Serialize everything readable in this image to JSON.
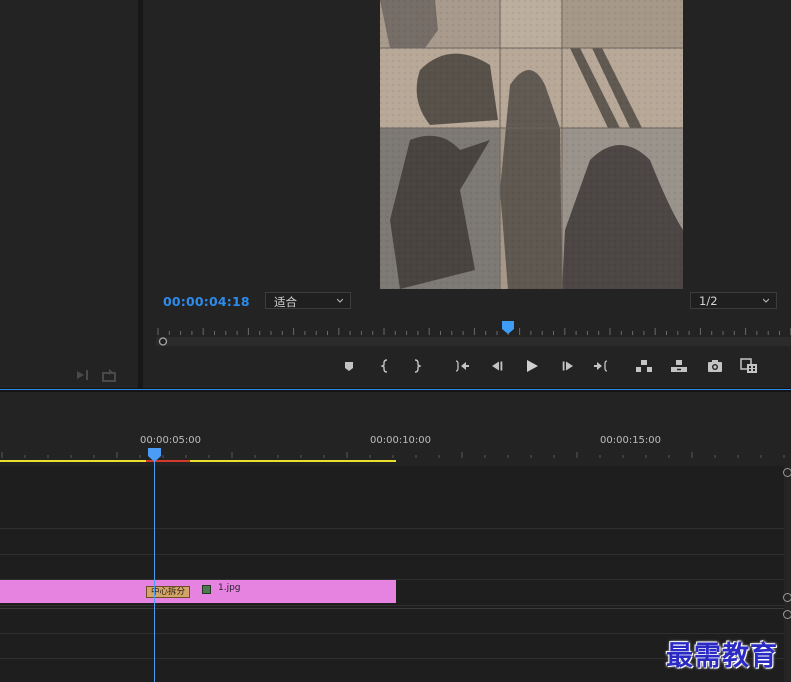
{
  "program_monitor": {
    "timecode": "00:00:04:18",
    "zoom_select": "适合",
    "resolution_select": "1/2",
    "timecode_color": "#2d8ceb"
  },
  "transport_controls": [
    {
      "name": "add-marker-button",
      "icon": "marker-icon"
    },
    {
      "name": "mark-in-button",
      "icon": "mark-in-icon"
    },
    {
      "name": "mark-out-button",
      "icon": "mark-out-icon"
    },
    {
      "name": "go-to-in-button",
      "icon": "go-to-in-icon"
    },
    {
      "name": "step-back-button",
      "icon": "step-back-icon"
    },
    {
      "name": "play-button",
      "icon": "play-icon"
    },
    {
      "name": "step-forward-button",
      "icon": "step-forward-icon"
    },
    {
      "name": "go-to-out-button",
      "icon": "go-to-out-icon"
    },
    {
      "name": "lift-button",
      "icon": "lift-icon"
    },
    {
      "name": "extract-button",
      "icon": "extract-icon"
    },
    {
      "name": "export-frame-button",
      "icon": "camera-icon"
    },
    {
      "name": "comparison-view-button",
      "icon": "comparison-icon"
    }
  ],
  "timeline": {
    "ruler_labels": [
      "00:00:05:00",
      "00:00:10:00",
      "00:00:15:00"
    ],
    "clip": {
      "name": "1.jpg",
      "effect_label": "中心拆分",
      "color": "#e682df"
    },
    "work_area_color": "#e8e02a",
    "playhead_color": "#4b9cf5"
  },
  "watermark": "最需教育"
}
